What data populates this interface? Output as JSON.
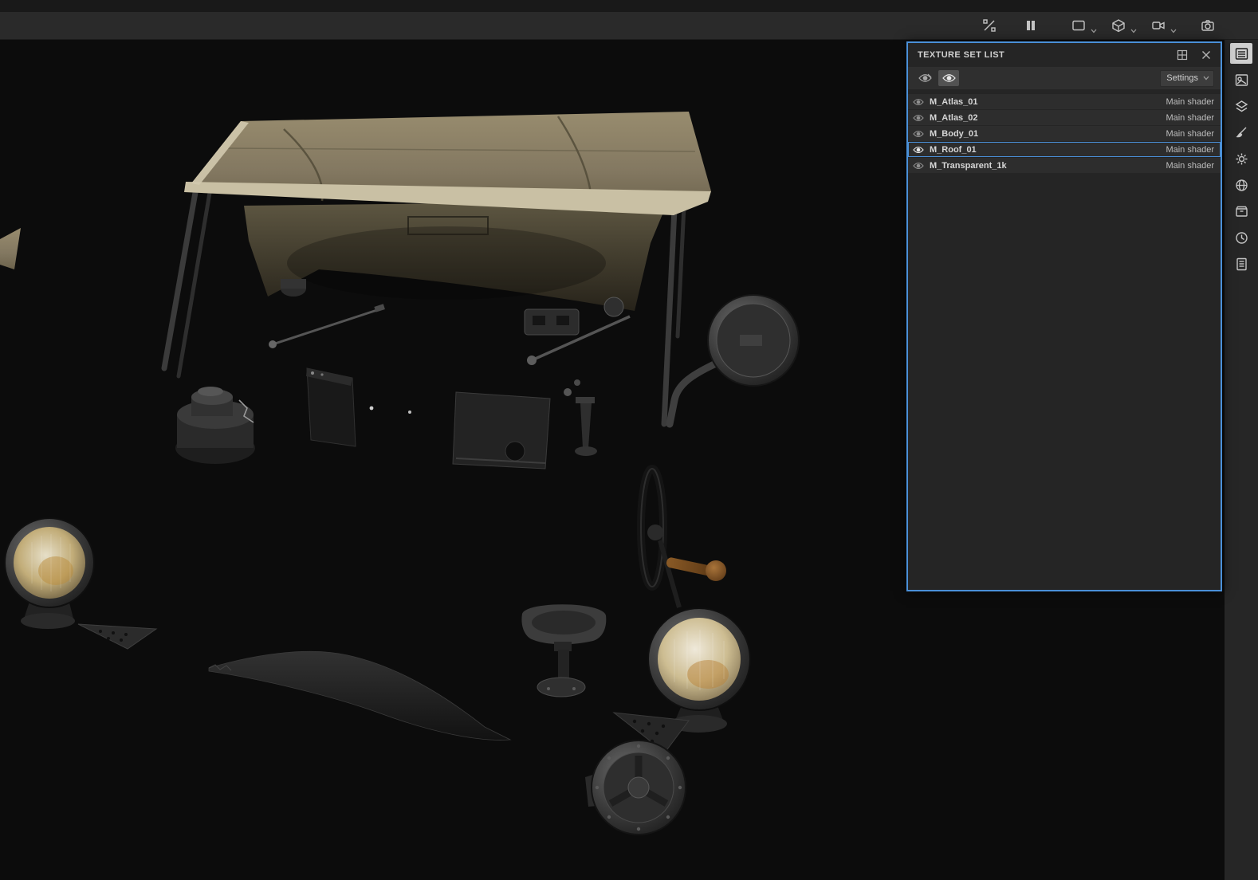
{
  "accent_color": "#4a90d8",
  "toolbar": {
    "icons": [
      {
        "name": "symmetry-off-icon"
      },
      {
        "name": "pause-engine-icon"
      },
      {
        "name": "viewport-display-icon",
        "has_dropdown": true
      },
      {
        "name": "material-view-icon",
        "has_dropdown": true
      },
      {
        "name": "camera-view-icon",
        "has_dropdown": true
      },
      {
        "name": "screenshot-icon"
      }
    ]
  },
  "texture_set_list": {
    "title": "TEXTURE SET LIST",
    "settings_label": "Settings",
    "rows": [
      {
        "name": "M_Atlas_01",
        "shader": "Main shader",
        "visible": true,
        "selected": false
      },
      {
        "name": "M_Atlas_02",
        "shader": "Main shader",
        "visible": true,
        "selected": false
      },
      {
        "name": "M_Body_01",
        "shader": "Main shader",
        "visible": true,
        "selected": false
      },
      {
        "name": "M_Roof_01",
        "shader": "Main shader",
        "visible": true,
        "selected": true
      },
      {
        "name": "M_Transparent_1k",
        "shader": "Main shader",
        "visible": true,
        "selected": false
      }
    ]
  },
  "dock": {
    "icons": [
      "texture-set-list",
      "display-settings",
      "layers",
      "brush",
      "tool-settings",
      "shader-settings",
      "assets",
      "history",
      "log"
    ]
  },
  "viewport": {
    "scene": "Exploded vintage-vehicle parts: canvas roof, rear-view mirror, air filter, headlights, steering wheel, seat, fender, horn, brackets"
  }
}
